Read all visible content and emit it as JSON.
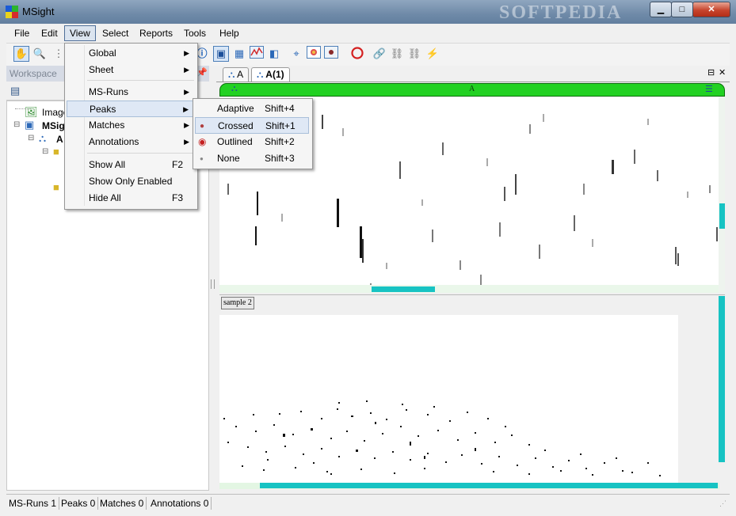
{
  "window": {
    "title": "MSight",
    "watermark": "SOFTPEDIA",
    "colors": {
      "sheet_header": "#22d122",
      "scroll_accent": "#17c3c3"
    }
  },
  "menubar": {
    "items": [
      "File",
      "Edit",
      "View",
      "Select",
      "Reports",
      "Tools",
      "Help"
    ]
  },
  "toolbar": {
    "icons": [
      "hand-tool-icon",
      "zoom-icon",
      "dotted-select-icon",
      "info-icon",
      "view-mode-icon",
      "grid-icon",
      "line-chart-icon",
      "image-view-icon",
      "crosshair-icon",
      "heatmap-icon",
      "peak-icon",
      "circle-icon",
      "link-icon",
      "chain-icon",
      "align-icon"
    ]
  },
  "workspace": {
    "title": "Workspace",
    "tree": [
      {
        "label": "Image"
      },
      {
        "label": "MSigh"
      },
      {
        "label": "A"
      }
    ]
  },
  "view_menu": {
    "items": [
      {
        "label": "Global",
        "submenu": true
      },
      {
        "label": "Sheet",
        "submenu": true
      },
      {
        "label": "MS-Runs",
        "submenu": true
      },
      {
        "label": "Peaks",
        "submenu": true
      },
      {
        "label": "Matches",
        "submenu": true
      },
      {
        "label": "Annotations",
        "submenu": true
      },
      {
        "label": "Show All",
        "shortcut": "F2"
      },
      {
        "label": "Show Only Enabled",
        "shortcut": ""
      },
      {
        "label": "Hide All",
        "shortcut": "F3"
      }
    ]
  },
  "peaks_menu": {
    "items": [
      {
        "label": "Adaptive",
        "shortcut": "Shift+4"
      },
      {
        "label": "Crossed",
        "shortcut": "Shift+1"
      },
      {
        "label": "Outlined",
        "shortcut": "Shift+2"
      },
      {
        "label": "None",
        "shortcut": "Shift+3"
      }
    ]
  },
  "tabs": [
    {
      "label": "A"
    },
    {
      "label": "A(1)"
    }
  ],
  "sheet": {
    "header_label": "A",
    "sample_label": "sample 2"
  },
  "statusbar": {
    "ms_runs": "MS-Runs 1",
    "peaks": "Peaks 0",
    "matches": "Matches 0",
    "annotations": "Annotations 0"
  }
}
